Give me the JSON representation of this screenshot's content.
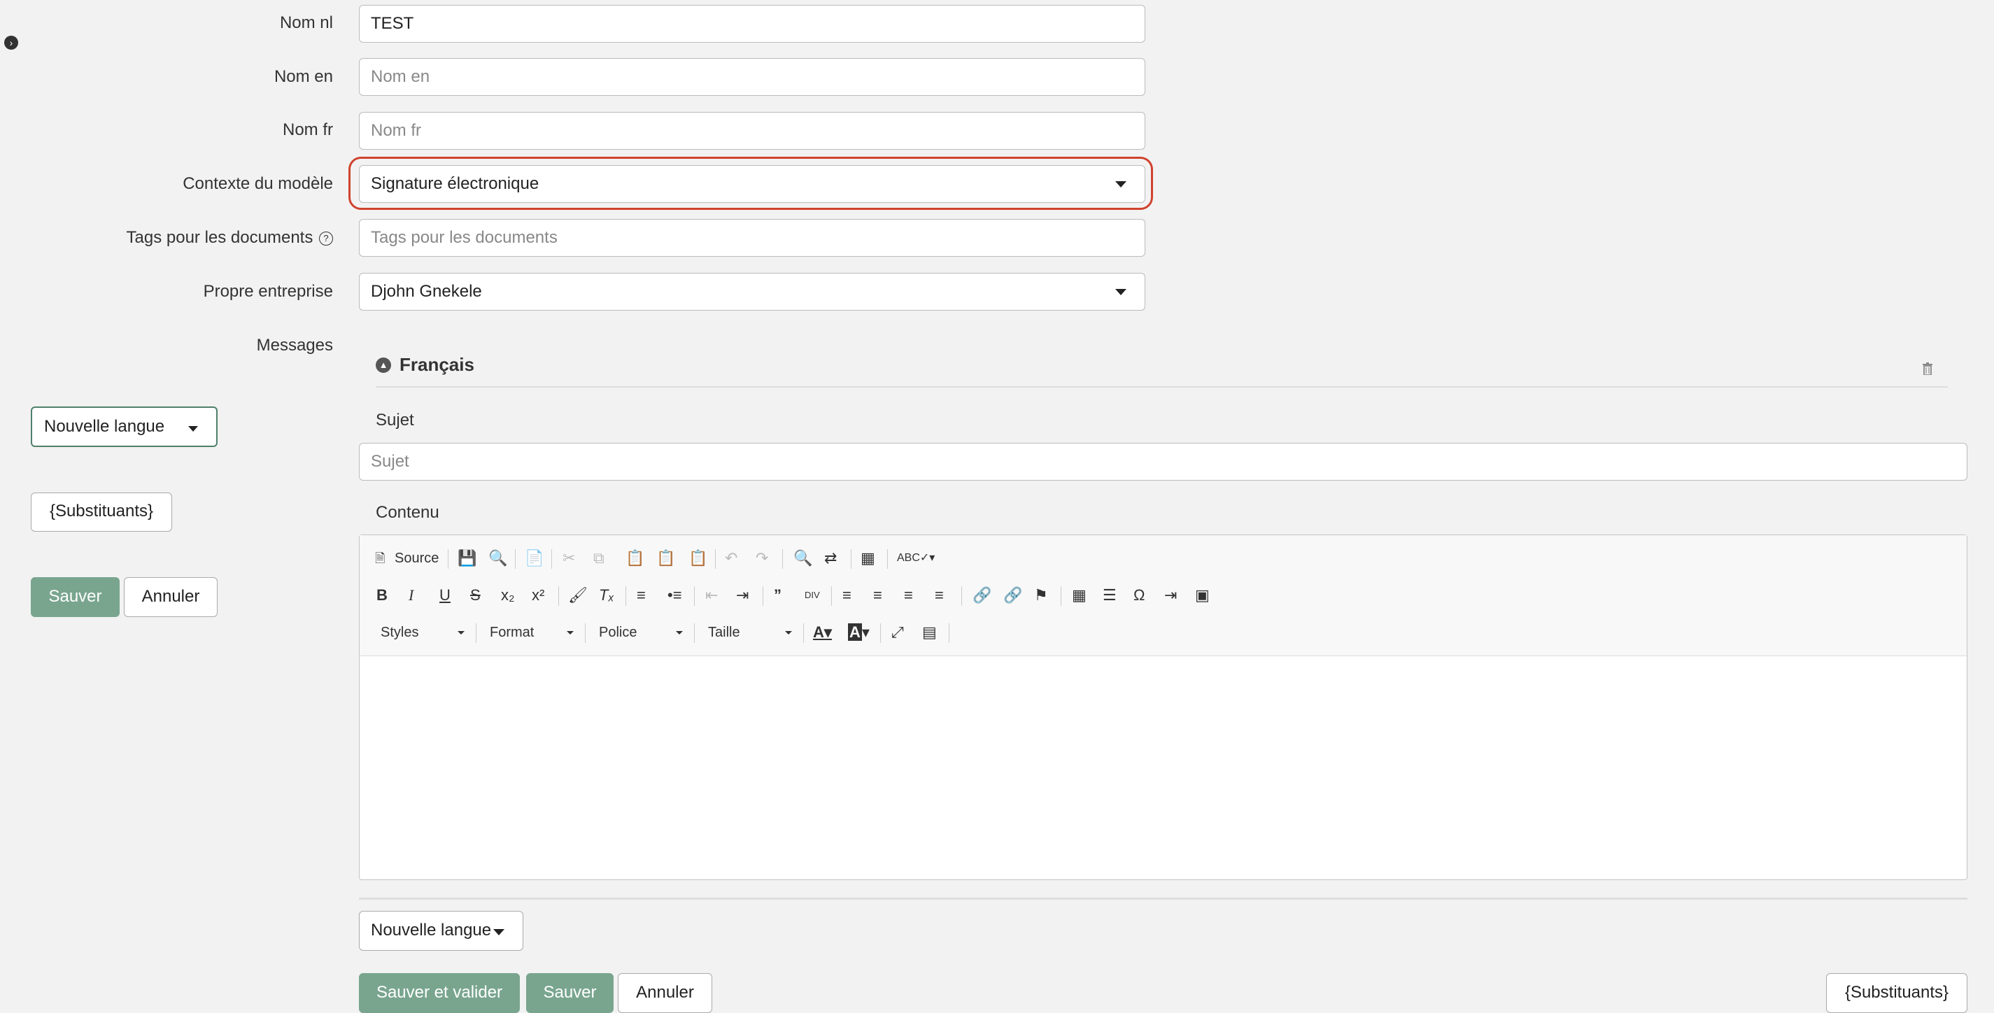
{
  "form": {
    "nom_nl": {
      "label": "Nom nl",
      "value": "TEST"
    },
    "nom_en": {
      "label": "Nom en",
      "placeholder": "Nom en"
    },
    "nom_fr": {
      "label": "Nom fr",
      "placeholder": "Nom fr"
    },
    "contexte": {
      "label": "Contexte du modèle",
      "value": "Signature électronique"
    },
    "tags": {
      "label": "Tags pour les documents",
      "placeholder": "Tags pour les documents"
    },
    "entreprise": {
      "label": "Propre entreprise",
      "value": "Djohn Gnekele"
    },
    "messages_label": "Messages"
  },
  "sidebar": {
    "nouvelle_langue": "Nouvelle langue",
    "substituants": "{Substituants}",
    "sauver": "Sauver",
    "annuler": "Annuler"
  },
  "message": {
    "language": "Français",
    "sujet_label": "Sujet",
    "sujet_placeholder": "Sujet",
    "contenu_label": "Contenu"
  },
  "editor": {
    "source_label": "Source",
    "styles": "Styles",
    "format": "Format",
    "police": "Police",
    "taille": "Taille"
  },
  "footer": {
    "nouvelle_langue": "Nouvelle langue",
    "sauver_valider": "Sauver et valider",
    "sauver": "Sauver",
    "annuler": "Annuler",
    "substituants": "{Substituants}"
  },
  "colors": {
    "accent_green": "#79a58f",
    "highlight_red": "#d0432e"
  }
}
